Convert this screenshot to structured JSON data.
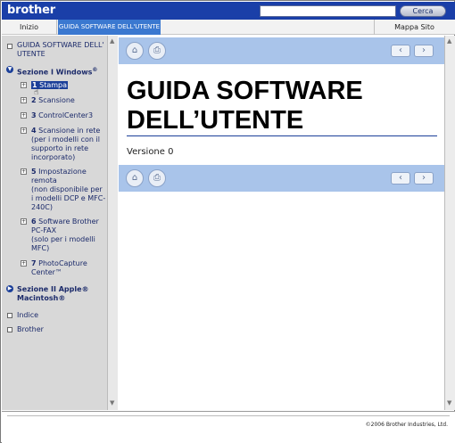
{
  "header": {
    "logo": "brother",
    "search_placeholder": "",
    "search_button": "Cerca"
  },
  "nav": {
    "home": "Inizio",
    "guide": "GUIDA SOFTWARE DELL'UTENTE",
    "site_map": "Mappa Sito"
  },
  "sidebar": {
    "items": [
      {
        "label": "GUIDA SOFTWARE DELL' UTENTE"
      },
      {
        "label": "Sezione I Windows",
        "sup": "®"
      },
      {
        "num": "1",
        "label": "Stampa"
      },
      {
        "num": "2",
        "label": "Scansione"
      },
      {
        "num": "3",
        "label": "ControlCenter3"
      },
      {
        "num": "4",
        "label": "Scansione in rete",
        "detail": "(per i modelli con il supporto in rete incorporato)"
      },
      {
        "num": "5",
        "label": "Impostazione remota",
        "detail": "(non disponibile per i modelli DCP e MFC-240C)"
      },
      {
        "num": "6",
        "label": "Software Brother PC-FAX",
        "detail": "(solo per i modelli MFC)"
      },
      {
        "num": "7",
        "label": "PhotoCapture Center™"
      },
      {
        "label": "Sezione II Apple® Macintosh®"
      },
      {
        "label": "Indice"
      },
      {
        "label": "Brother"
      }
    ]
  },
  "main": {
    "title": "GUIDA SOFTWARE DELL’UTENTE",
    "version": "Versione 0"
  },
  "footer": {
    "copyright": "©2006 Brother Industries, Ltd."
  },
  "colors": {
    "header_blue": "#1a3fa8",
    "nav_active": "#3a78d0",
    "band_blue": "#a9c4ea",
    "link_blue": "#1b2a6a"
  },
  "icons": [
    "home-icon",
    "printer-icon",
    "prev-arrow-icon",
    "next-arrow-icon",
    "plus-box-icon",
    "bullet-icon"
  ]
}
